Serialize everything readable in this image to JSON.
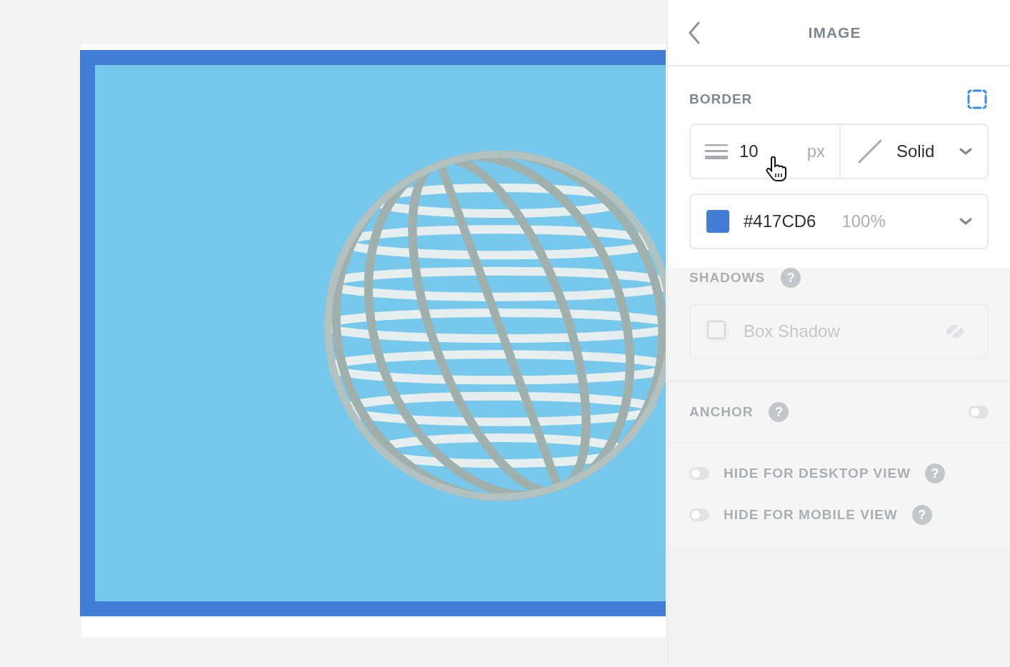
{
  "panel": {
    "title": "IMAGE"
  },
  "border": {
    "title": "BORDER",
    "width": {
      "value": "10",
      "unit": "px"
    },
    "style": {
      "value": "Solid"
    },
    "color": {
      "value": "#417CD6",
      "opacity": "100%"
    }
  },
  "shadows": {
    "title": "SHADOWS",
    "help": "?",
    "disabled": true,
    "items": [
      {
        "label": "Box Shadow",
        "visible": false
      }
    ]
  },
  "anchor": {
    "title": "ANCHOR",
    "help": "?",
    "disabled": true,
    "on": false
  },
  "visibility": {
    "disabled": true,
    "toggles": [
      {
        "label": "HIDE FOR DESKTOP VIEW",
        "help": "?",
        "on": false
      },
      {
        "label": "HIDE FOR MOBILE VIEW",
        "help": "?",
        "on": false
      }
    ]
  }
}
